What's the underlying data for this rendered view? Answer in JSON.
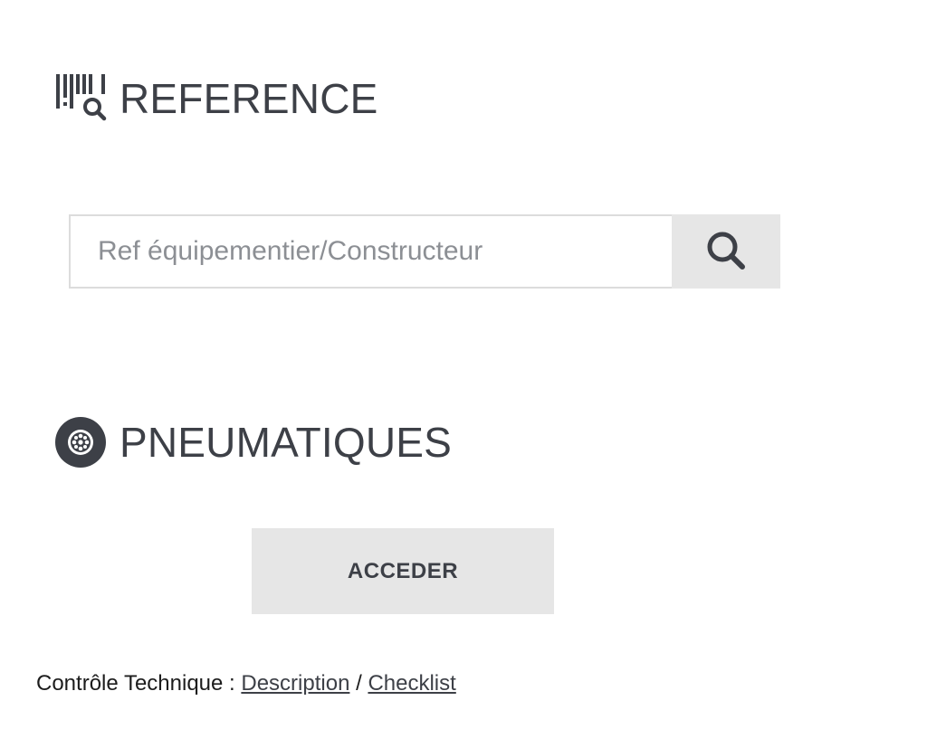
{
  "reference": {
    "title": "REFERENCE",
    "icon": "barcode-search-icon",
    "search_placeholder": "Ref équipementier/Constructeur",
    "search_value": "",
    "search_button_icon": "search-icon"
  },
  "tyres": {
    "title": "PNEUMATIQUES",
    "icon": "wheel-icon",
    "access_label": "ACCEDER"
  },
  "footer": {
    "label": "Contrôle Technique : ",
    "link_description": "Description",
    "separator": " / ",
    "link_checklist": "Checklist"
  },
  "colors": {
    "text": "#3d4047",
    "button_bg": "#e6e6e6",
    "input_border": "#dcdcdc"
  }
}
